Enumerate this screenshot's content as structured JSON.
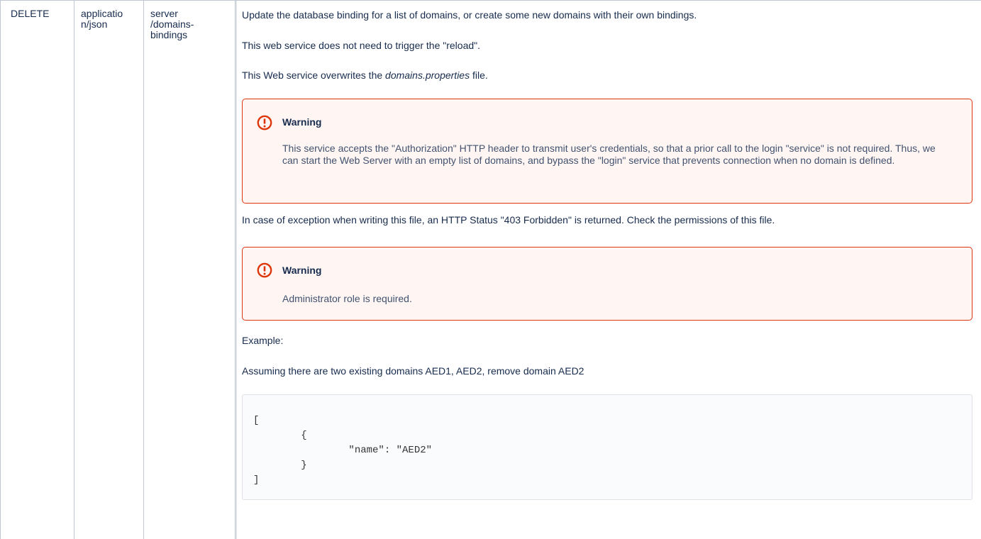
{
  "row": {
    "method": "DELETE",
    "content_type_line1": "applicatio",
    "content_type_line2": "n/json",
    "path_line1": "server",
    "path_line2": "/domains-",
    "path_line3": "bindings"
  },
  "description": {
    "intro": "Update the database binding for a list of domains, or create some new domains with their own bindings.",
    "reload_note": "This web service does not need to trigger the \"reload\".",
    "overwrite_prefix": "This Web service overwrites the ",
    "overwrite_file": "domains.properties",
    "overwrite_suffix": " file.",
    "warning1": {
      "title": "Warning",
      "body": "This service accepts the \"Authorization\" HTTP header to transmit user's credentials, so that a prior call to the login \"service\" is not required. Thus, we can start the Web Server with an empty list of domains, and bypass the \"login\" service that prevents connection when no domain is defined."
    },
    "exception_note": "In case of exception when writing this file, an HTTP Status \"403 Forbidden\" is returned. Check the permissions of this file.",
    "warning2": {
      "title": "Warning",
      "body": "Administrator role is required."
    },
    "example_label": "Example:",
    "example_desc": "Assuming there are two existing domains AED1, AED2, remove domain AED2",
    "code": {
      "line1": "[",
      "line2": "        {",
      "line3": "                \"name\": \"AED2\"",
      "line4": "        }",
      "line5": "]"
    }
  },
  "colors": {
    "warning_border": "#de350b",
    "warning_background": "#fff6f4",
    "warning_icon": "#de350b",
    "text": "#172b4d",
    "table_border": "#c1c7d0"
  },
  "icons": {
    "warning": "error-circle-icon"
  }
}
